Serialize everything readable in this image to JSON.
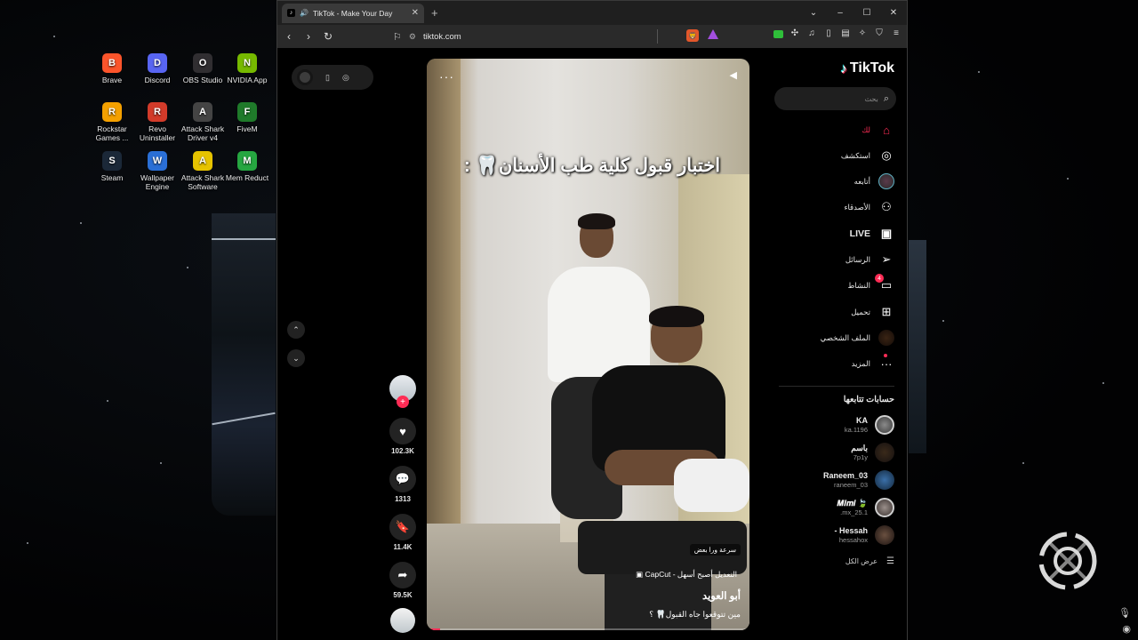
{
  "desktop": {
    "icons": [
      {
        "label": "Brave",
        "icon": "brave-icon",
        "color": "#fb542b"
      },
      {
        "label": "Discord",
        "icon": "discord-icon",
        "color": "#5865f2"
      },
      {
        "label": "OBS Studio",
        "icon": "obs-icon",
        "color": "#302e31"
      },
      {
        "label": "NVIDIA App",
        "icon": "nvidia-icon",
        "color": "#76b900"
      },
      {
        "label": "Rockstar Games ...",
        "icon": "rockstar-icon",
        "color": "#f4a000"
      },
      {
        "label": "Revo Uninstaller",
        "icon": "revo-icon",
        "color": "#d23b2a"
      },
      {
        "label": "Attack Shark Driver v4",
        "icon": "attack-shark-icon",
        "color": "#444444"
      },
      {
        "label": "FiveM",
        "icon": "fivem-icon",
        "color": "#1f7a2a"
      },
      {
        "label": "Steam",
        "icon": "steam-icon",
        "color": "#1b2838"
      },
      {
        "label": "Wallpaper Engine",
        "icon": "wallpaper-engine-icon",
        "color": "#2a6fd6"
      },
      {
        "label": "Attack Shark Software",
        "icon": "attack-shark-software-icon",
        "color": "#e6c300"
      },
      {
        "label": "Mem Reduct",
        "icon": "mem-reduct-icon",
        "color": "#26a641"
      }
    ]
  },
  "browser": {
    "tab_title": "TikTok - Make Your Day",
    "url": "tiktok.com",
    "new_tab": "+",
    "win_controls": [
      "⌄",
      "–",
      "☐",
      "✕"
    ]
  },
  "tiktok": {
    "brand": "TikTok",
    "search_placeholder": "بحث",
    "nav": [
      {
        "label": "لك",
        "icon": "home-icon",
        "glyph": "⌂"
      },
      {
        "label": "استكشف",
        "icon": "compass-icon",
        "glyph": "◎"
      },
      {
        "label": "أتابعه",
        "icon": "following-avatar-icon",
        "glyph": ""
      },
      {
        "label": "الأصدقاء",
        "icon": "friends-icon",
        "glyph": "⚇"
      },
      {
        "label": "LIVE",
        "icon": "live-icon",
        "glyph": "▣"
      },
      {
        "label": "الرسائل",
        "icon": "messages-icon",
        "glyph": "➢"
      },
      {
        "label": "النشاط",
        "icon": "activity-icon",
        "glyph": "▭",
        "badge": "4"
      },
      {
        "label": "تحميل",
        "icon": "upload-icon",
        "glyph": "⊞"
      },
      {
        "label": "الملف الشخصي",
        "icon": "profile-avatar-icon",
        "glyph": ""
      },
      {
        "label": "المزيد",
        "icon": "more-icon",
        "glyph": "···"
      }
    ],
    "following_title": "حسابات تتابعها",
    "accounts": [
      {
        "name": "KA",
        "username": "ka.1196"
      },
      {
        "name": "باسم",
        "username": "7p1y"
      },
      {
        "name": "Raneem_03",
        "username": "raneem_03"
      },
      {
        "name": "🍃 𝑴𝒊𝒎𝒊",
        "username": "mx_25.1."
      },
      {
        "name": "Hessah -",
        "username": "hessahox"
      }
    ],
    "see_all": "عرض الكل",
    "video": {
      "caption": "اختبار قبول كلية طب الأسنان🦷 :",
      "tag": "سرعة ورا بعض",
      "capcut": "التعديل أصبح أسهل - CapCut",
      "author": "أبو العويد",
      "description": "مين تتوقعوا جاه القبول🦷 ؟",
      "progress_percent": 4
    },
    "actions": {
      "likes": "102.3K",
      "comments": "1313",
      "saves": "11.4K",
      "shares": "59.5K"
    }
  }
}
